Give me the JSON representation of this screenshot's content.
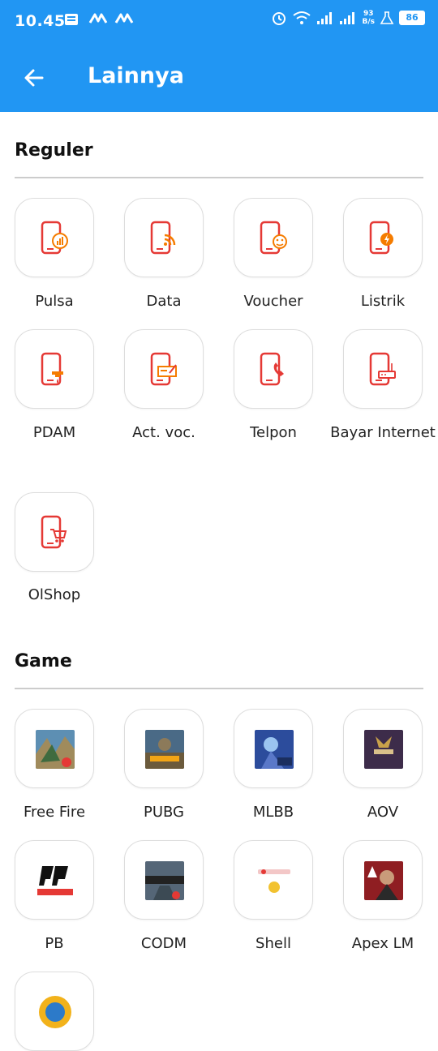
{
  "status_bar": {
    "time": "10.45",
    "net_speed_top": "93",
    "net_speed_bottom": "B/s",
    "battery": "86"
  },
  "app_bar": {
    "title": "Lainnya"
  },
  "sections": {
    "reguler": {
      "title": "Reguler",
      "items": [
        {
          "label": "Pulsa",
          "icon": "phone-pulsa-icon"
        },
        {
          "label": "Data",
          "icon": "phone-data-icon"
        },
        {
          "label": "Voucher",
          "icon": "phone-voucher-icon"
        },
        {
          "label": "Listrik",
          "icon": "phone-electricity-icon"
        },
        {
          "label": "PDAM",
          "icon": "phone-water-icon"
        },
        {
          "label": "Act. voc.",
          "icon": "phone-activate-voucher-icon"
        },
        {
          "label": "Telpon",
          "icon": "phone-call-icon"
        },
        {
          "label": "Bayar Internet",
          "icon": "phone-router-icon"
        },
        {
          "label": "OlShop",
          "icon": "phone-cart-icon"
        }
      ]
    },
    "game": {
      "title": "Game",
      "items": [
        {
          "label": "Free Fire",
          "icon": "free-fire-icon"
        },
        {
          "label": "PUBG",
          "icon": "pubg-icon"
        },
        {
          "label": "MLBB",
          "icon": "mlbb-icon"
        },
        {
          "label": "AOV",
          "icon": "aov-icon"
        },
        {
          "label": "PB",
          "icon": "point-blank-icon"
        },
        {
          "label": "CODM",
          "icon": "codm-icon"
        },
        {
          "label": "Shell",
          "icon": "garena-shell-icon"
        },
        {
          "label": "Apex LM",
          "icon": "apex-legends-icon"
        }
      ]
    }
  },
  "colors": {
    "primary": "#2196F3",
    "icon_red": "#E53935",
    "icon_orange": "#F57C00"
  }
}
